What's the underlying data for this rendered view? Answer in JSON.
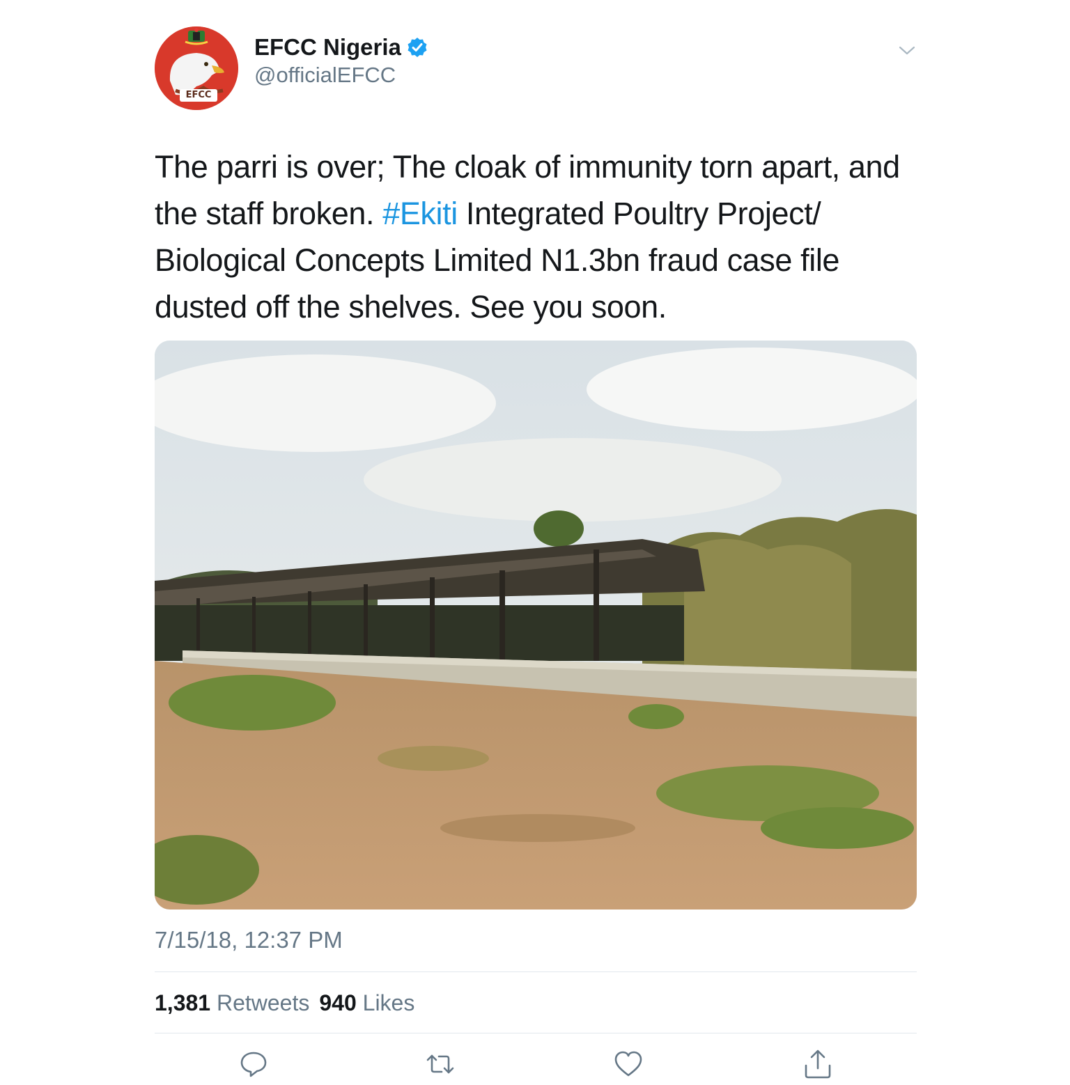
{
  "author": {
    "display_name": "EFCC Nigeria",
    "handle": "@officialEFCC",
    "verified": true,
    "avatar_badge_text": "EFCC",
    "avatar_color": "#d8392b"
  },
  "tweet": {
    "text_before_hashtag": "The parri is over; The cloak of immunity torn apart, and the staff broken. ",
    "hashtag": "#Ekiti",
    "text_after_hashtag": " Integrated Poultry Project/ Biological Concepts Limited N1.3bn fraud case file dusted off the shelves. See you soon.",
    "timestamp": "7/15/18, 12:37 PM"
  },
  "stats": {
    "retweets_count": "1,381",
    "retweets_label": "Retweets",
    "likes_count": "940",
    "likes_label": "Likes"
  },
  "actions": [
    "reply-icon",
    "retweet-icon",
    "like-icon",
    "share-icon"
  ],
  "colors": {
    "link": "#1b95e0",
    "secondary_text": "#657786",
    "verified_badge": "#1da1f2",
    "divider": "#e1e8ed"
  }
}
